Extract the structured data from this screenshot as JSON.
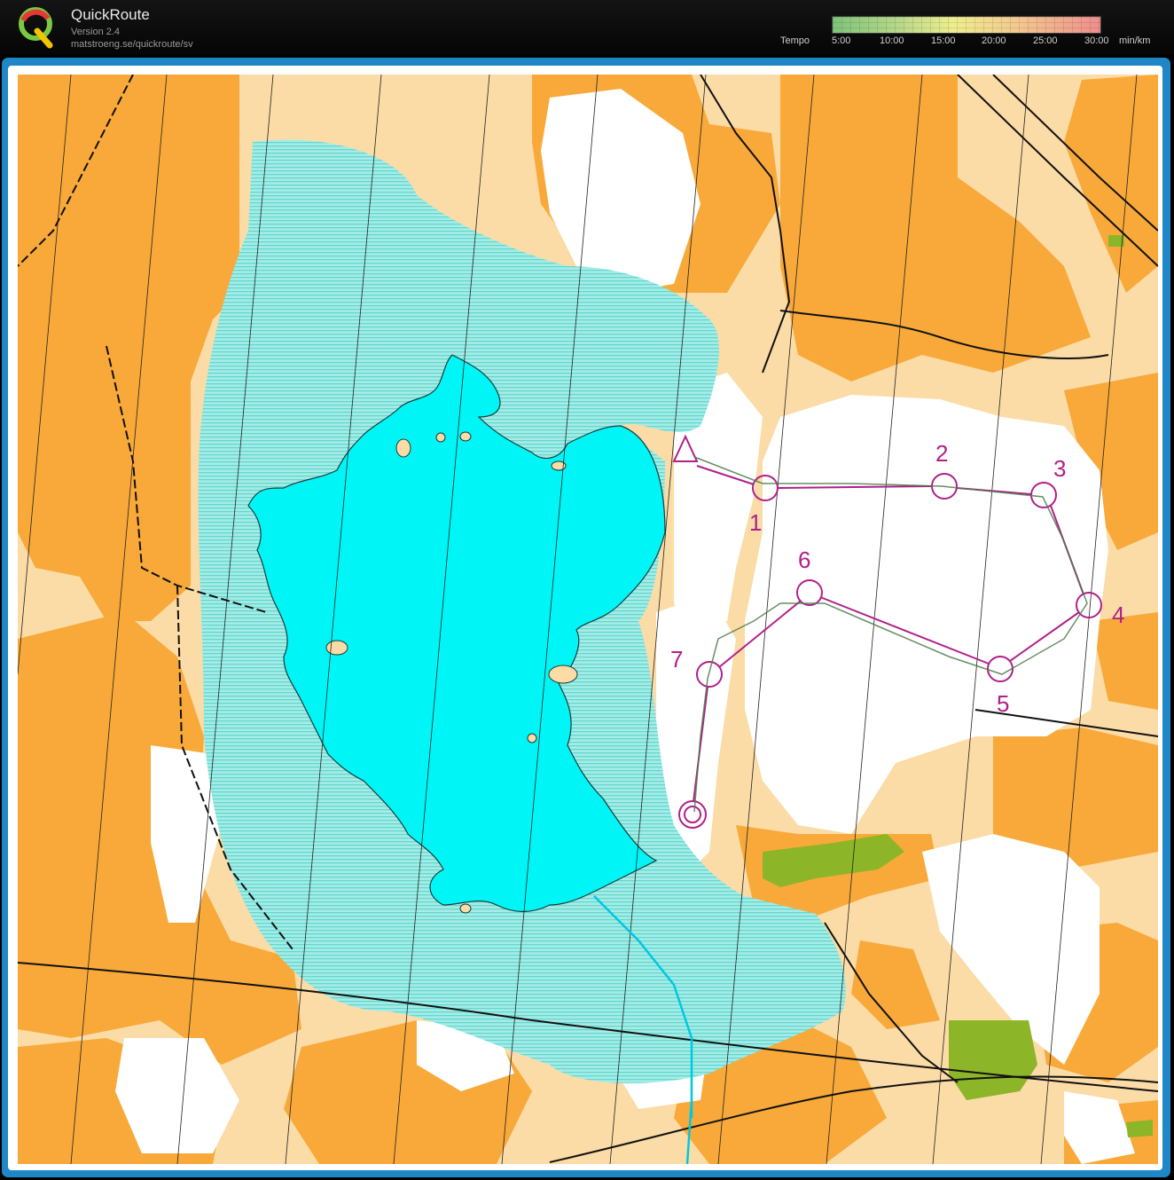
{
  "app": {
    "title": "QuickRoute",
    "version": "Version 2.4",
    "url": "matstroeng.se/quickroute/sv"
  },
  "tempo": {
    "label": "Tempo",
    "ticks": [
      "5:00",
      "10:00",
      "15:00",
      "20:00",
      "25:00",
      "30:00"
    ],
    "unit": "min/km",
    "colors": [
      "#7fc37a",
      "#eeee8e",
      "#ee8e8e"
    ]
  },
  "course": {
    "color": "#b0208a",
    "start": "triangle",
    "finish": "double-circle",
    "controls": [
      {
        "number": "1"
      },
      {
        "number": "2"
      },
      {
        "number": "3"
      },
      {
        "number": "4"
      },
      {
        "number": "5"
      },
      {
        "number": "6"
      },
      {
        "number": "7"
      }
    ]
  },
  "colors": {
    "frame": "#1f86c8",
    "open_land": "#f8a93a",
    "rough_open": "#fbdba6",
    "marsh": "#9ee8e0",
    "water": "#00f6f6",
    "vegetation_green": "#8cb527",
    "route": "#4d7a4a"
  }
}
